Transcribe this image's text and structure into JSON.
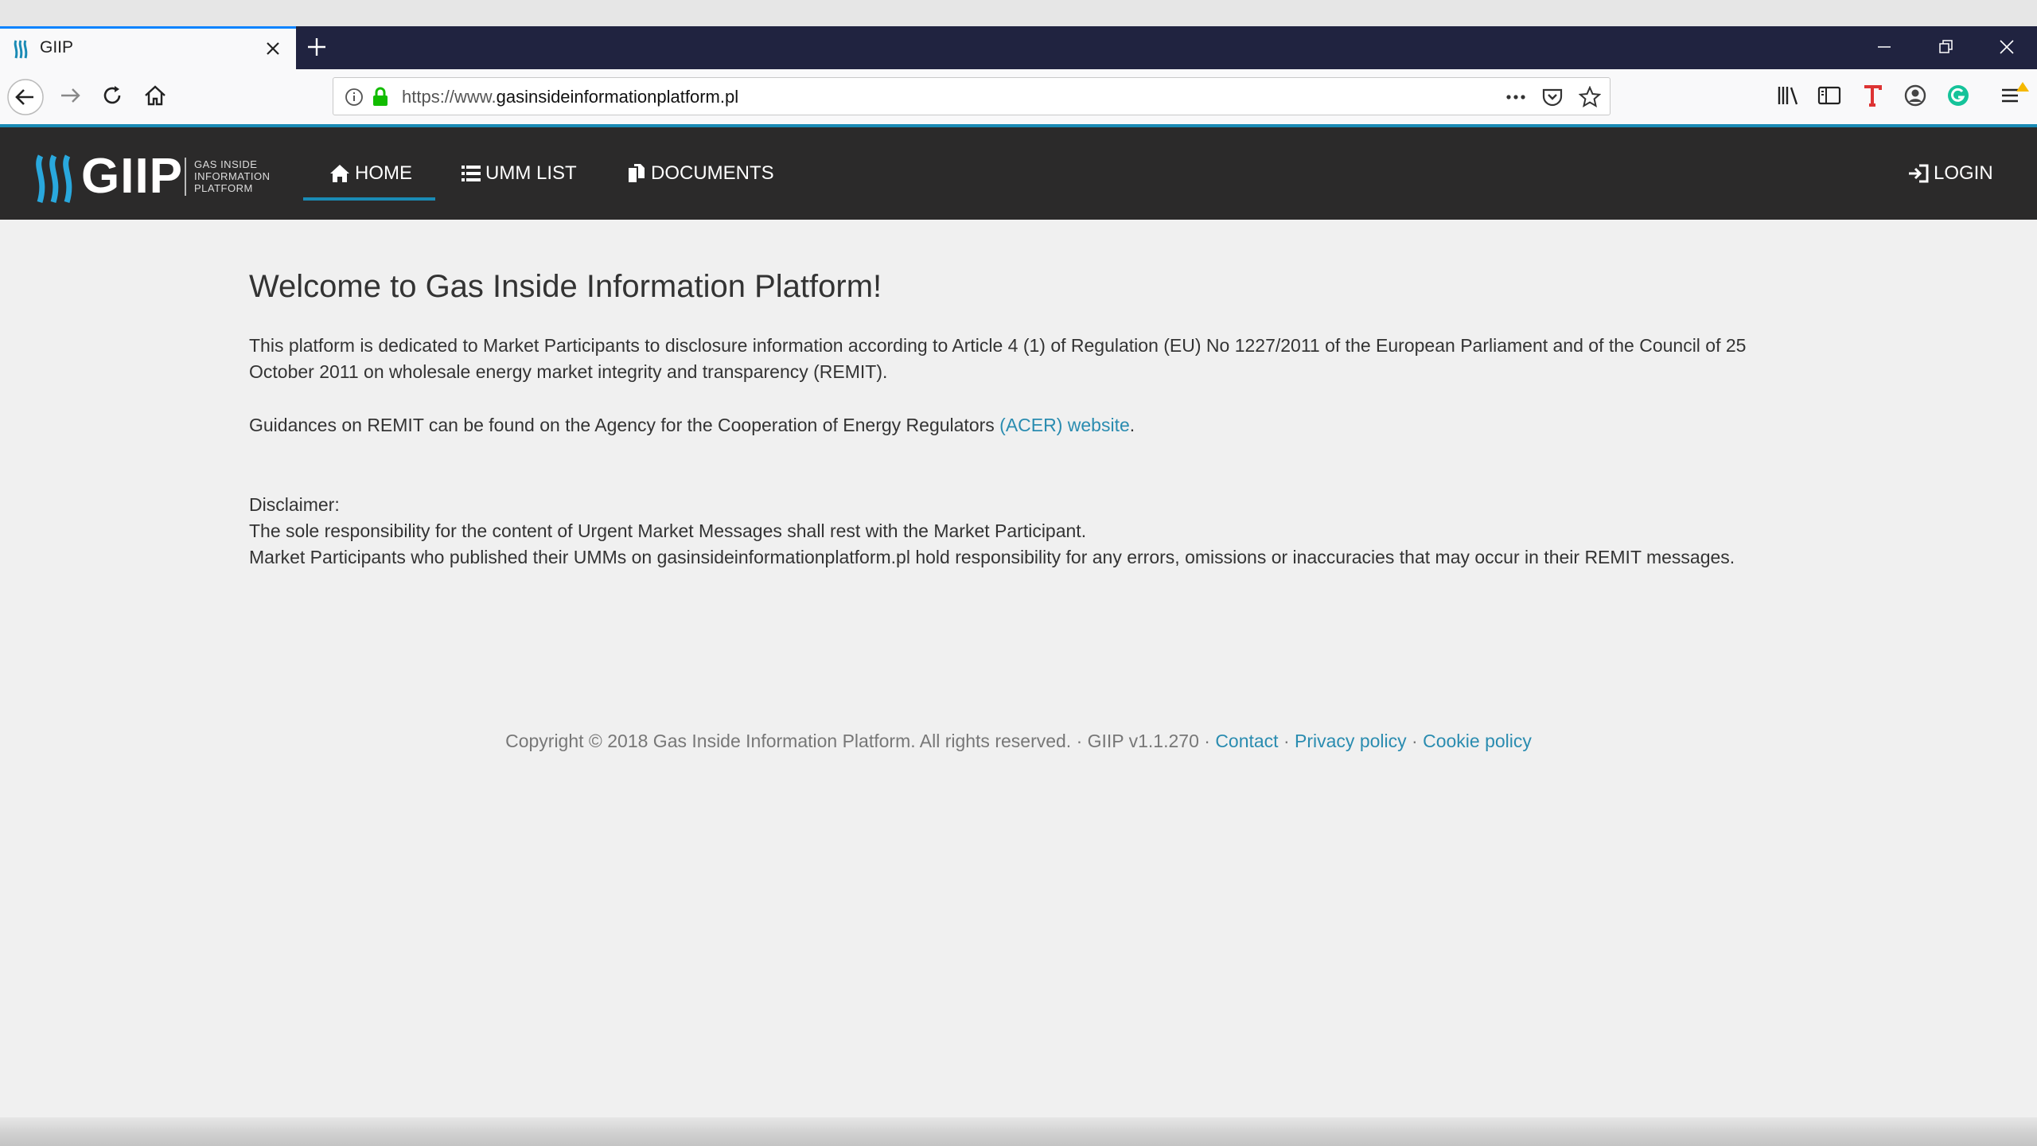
{
  "browser": {
    "tab_title": "GIIP",
    "url_prefix": "https://www.",
    "url_domain": "gasinsideinformationplatform.pl",
    "accent_color": "#0a84ff"
  },
  "site": {
    "logo_text": "GIIP",
    "logo_sub": "GAS INSIDE INFORMATION PLATFORM",
    "nav": {
      "home": "HOME",
      "umm_list": "UMM LIST",
      "documents": "DOCUMENTS",
      "login": "LOGIN"
    },
    "brand_color": "#1a8bb5",
    "header_bg": "#2b2a2a"
  },
  "main": {
    "title": "Welcome to Gas Inside Information Platform!",
    "intro": "This platform is dedicated to Market Participants to disclosure information according to Article 4 (1) of Regulation (EU) No 1227/2011 of the European Parliament and of the Council of 25 October 2011 on wholesale energy market integrity and transparency (REMIT).",
    "guidance_prefix": "Guidances on REMIT can be found on the Agency for the Cooperation of Energy Regulators ",
    "guidance_link": "(ACER) website",
    "guidance_suffix": ".",
    "disclaimer_label": "Disclaimer:",
    "disclaimer_1": "The sole responsibility for the content of Urgent Market Messages shall rest with the Market Participant.",
    "disclaimer_2": "Market Participants who published their UMMs on gasinsideinformationplatform.pl hold responsibility for any errors, omissions or inaccuracies that may occur in their REMIT messages."
  },
  "footer": {
    "copyright": "Copyright © 2018 Gas Inside Information Platform. All rights reserved. · GIIP v1.1.270 · ",
    "contact": "Contact",
    "sep1": " · ",
    "privacy": "Privacy policy",
    "sep2": " · ",
    "cookie": "Cookie policy"
  }
}
